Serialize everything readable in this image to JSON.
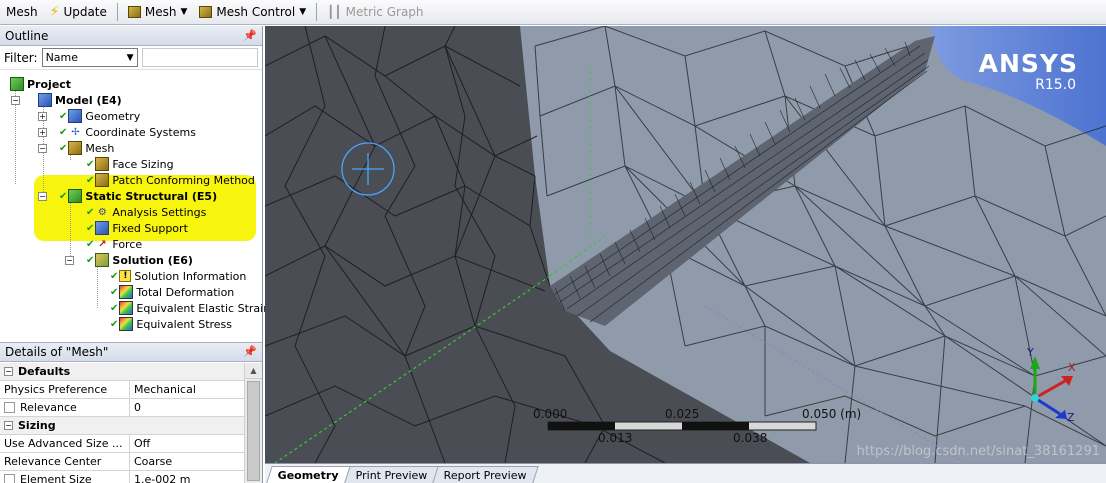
{
  "toolbar": {
    "mesh_label": "Mesh",
    "update_label": "Update",
    "mesh_menu_label": "Mesh",
    "mesh_control_label": "Mesh Control",
    "metric_graph_label": "Metric Graph"
  },
  "outline": {
    "title": "Outline",
    "filter_label": "Filter:",
    "filter_value": "Name",
    "tree": {
      "project": "Project",
      "model": "Model (E4)",
      "geometry": "Geometry",
      "coordinate_systems": "Coordinate Systems",
      "mesh": "Mesh",
      "face_sizing": "Face Sizing",
      "patch_conforming": "Patch Conforming Method",
      "static_structural": "Static Structural (E5)",
      "analysis_settings": "Analysis Settings",
      "fixed_support": "Fixed Support",
      "force": "Force",
      "solution": "Solution (E6)",
      "solution_information": "Solution Information",
      "total_deformation": "Total Deformation",
      "equivalent_elastic_strain": "Equivalent Elastic Strain",
      "equivalent_stress": "Equivalent Stress"
    }
  },
  "details": {
    "title": "Details of \"Mesh\"",
    "groups": {
      "defaults": "Defaults",
      "sizing": "Sizing"
    },
    "rows": {
      "physics_preference": {
        "key": "Physics Preference",
        "value": "Mechanical"
      },
      "relevance": {
        "key": "Relevance",
        "value": "0"
      },
      "use_advanced_size": {
        "key": "Use Advanced Size ...",
        "value": "Off"
      },
      "relevance_center": {
        "key": "Relevance Center",
        "value": "Coarse"
      },
      "element_size": {
        "key": "Element Size",
        "value": "1.e-002 m"
      }
    }
  },
  "viewport": {
    "brand": "ANSYS",
    "version": "R15.0",
    "scale": {
      "t0": "0.000",
      "t1": "0.025",
      "t2": "0.050 (m)",
      "m1": "0.013",
      "m2": "0.038"
    },
    "axes": {
      "x": "X",
      "y": "Y",
      "z": "Z"
    },
    "watermark": "https://blog.csdn.net/sinat_38161291"
  },
  "tabs": {
    "geometry": "Geometry",
    "print_preview": "Print Preview",
    "report_preview": "Report Preview"
  },
  "colors": {
    "highlight": "#f7f300",
    "dark_region": "#4a4d53",
    "light_region": "#8f9aaa",
    "corner_blue": "#5b7fd4"
  }
}
